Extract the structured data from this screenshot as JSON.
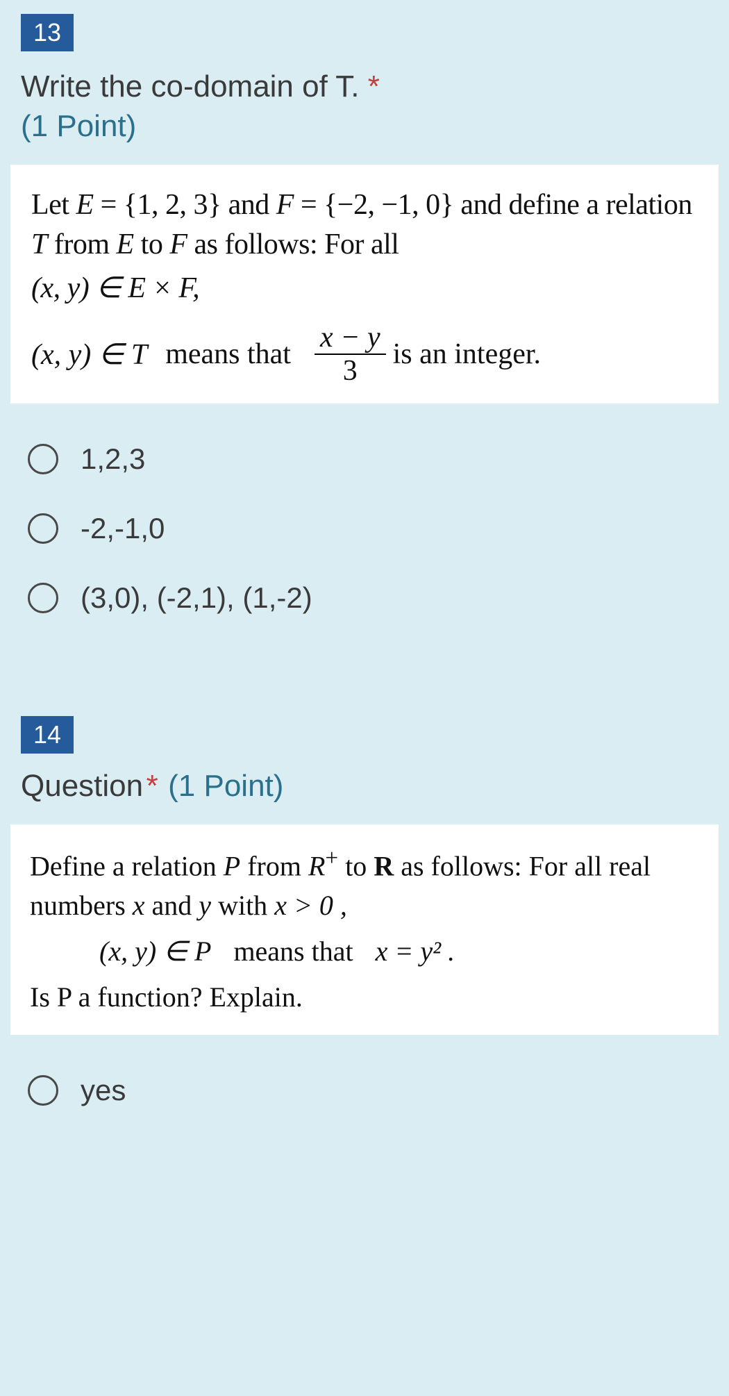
{
  "q13": {
    "number": "13",
    "title": "Write the co-domain of T.",
    "required": "*",
    "points": "(1 Point)",
    "image": {
      "p1a": "Let ",
      "E": "E",
      "eq1": " = {1, 2, 3} and ",
      "F": "F",
      "eq2": " = {−2, −1, 0} and define a relation ",
      "T": "T",
      "p1b": " from ",
      "p1c": " to ",
      "p1d": " as follows: For all",
      "p2": "(x, y) ∈ E × F,",
      "p3a": "(x, y) ∈ T",
      "p3b": "means that",
      "frac_top": "x − y",
      "frac_bot": "3",
      "p3c": " is an integer."
    },
    "options": [
      "1,2,3",
      "-2,-1,0",
      "(3,0), (-2,1), (1,-2)"
    ]
  },
  "q14": {
    "number": "14",
    "title": "Question",
    "required": "*",
    "points": "(1 Point)",
    "image": {
      "l1a": "Define a relation ",
      "P": "P",
      "l1b": " from ",
      "Rplus": "R",
      "l1c": " to ",
      "R": "R",
      "l1d": " as follows: For all real numbers ",
      "x": "x",
      "l1e": " and ",
      "y": "y",
      "l1f": " with ",
      "cond": "x > 0 ,",
      "l2a": "(x, y) ∈ P",
      "l2b": "means that",
      "l2c": "x = y² .",
      "l3": "Is P a function? Explain."
    },
    "options": [
      "yes"
    ]
  }
}
